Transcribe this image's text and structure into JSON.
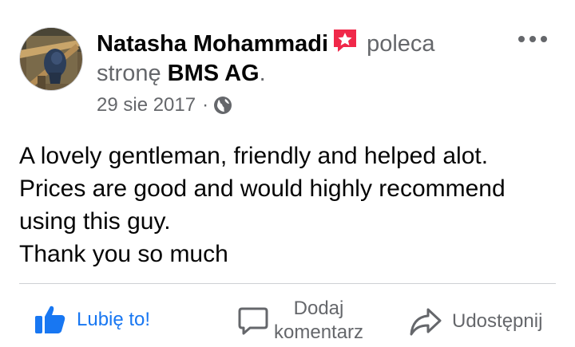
{
  "post": {
    "author": "Natasha Mohammadi",
    "recommends_text": "poleca",
    "page_prefix": "stronę",
    "page_name": "BMS AG",
    "page_suffix": ".",
    "date": "29 sie 2017",
    "separator": "·",
    "body_lines": [
      "A lovely gentleman, friendly and helped alot.",
      "Prices are good and would highly recommend",
      "using this guy.",
      "Thank you so much"
    ]
  },
  "icons": {
    "avatar": "profile-photo",
    "recommend": "recommend-badge-icon",
    "privacy": "globe-icon",
    "more": "more-options-icon",
    "like": "thumbs-up-icon",
    "comment": "speech-bubble-icon",
    "share": "share-arrow-icon"
  },
  "actions": {
    "like": "Lubię to!",
    "comment_line1": "Dodaj",
    "comment_line2": "komentarz",
    "share": "Udostępnij"
  },
  "colors": {
    "like_blue": "#1877f2",
    "recommend_red": "#f02849",
    "secondary_text": "#65676b"
  }
}
